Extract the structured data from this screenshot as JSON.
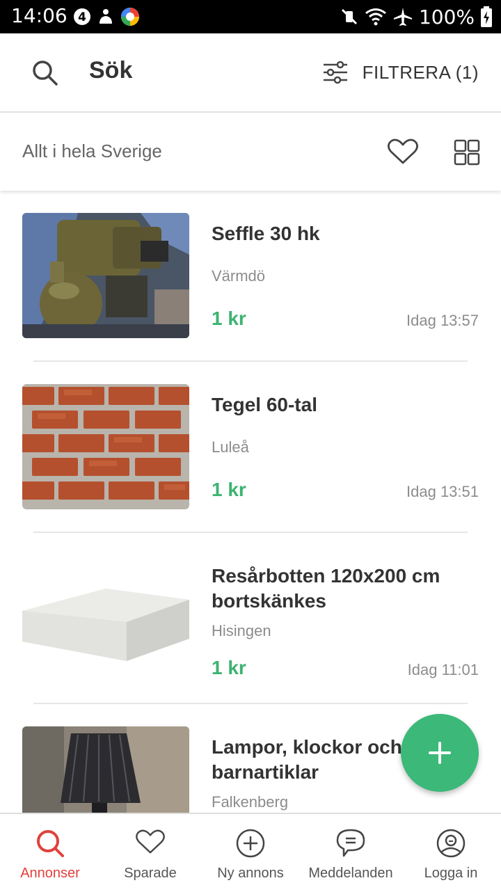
{
  "status_bar": {
    "time": "14:06",
    "battery": "100%"
  },
  "header": {
    "title": "Sök",
    "filter_label": "FILTRERA (1)"
  },
  "location_bar": {
    "location": "Allt i hela Sverige"
  },
  "listings": [
    {
      "title": "Seffle 30 hk",
      "location": "Värmdö",
      "price": "1 kr",
      "time": "Idag 13:57",
      "image": "engine-photo"
    },
    {
      "title": "Tegel 60-tal",
      "location": "Luleå",
      "price": "1 kr",
      "time": "Idag 13:51",
      "image": "brick-wall-photo"
    },
    {
      "title": "Resårbotten 120x200 cm bortskänkes",
      "location": "Hisingen",
      "price": "1 kr",
      "time": "Idag 11:01",
      "image": "bed-base-photo"
    },
    {
      "title": "Lampor, klockor och barnartiklar",
      "location": "Falkenberg",
      "price": "",
      "time": "",
      "image": "lamp-photo"
    }
  ],
  "bottom_nav": [
    {
      "label": "Annonser",
      "icon": "search-icon",
      "active": true
    },
    {
      "label": "Sparade",
      "icon": "heart-icon",
      "active": false
    },
    {
      "label": "Ny annons",
      "icon": "plus-circle-icon",
      "active": false
    },
    {
      "label": "Meddelanden",
      "icon": "chat-bubble-icon",
      "active": false
    },
    {
      "label": "Logga in",
      "icon": "user-circle-icon",
      "active": false
    }
  ],
  "colors": {
    "accent_green": "#3cb371",
    "active_red": "#e0413c",
    "fab_green": "#3cb878"
  }
}
